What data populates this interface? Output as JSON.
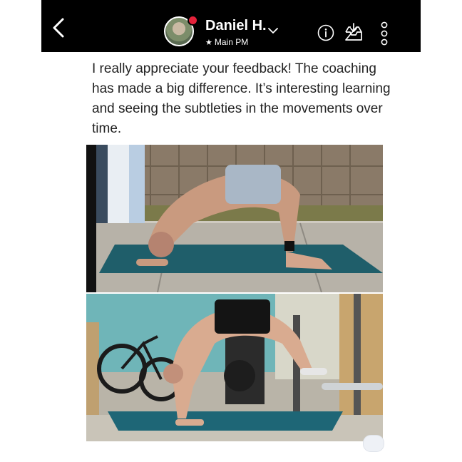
{
  "header": {
    "contact_name": "Daniel H.",
    "contact_subtitle": "Main PM",
    "subtitle_icon": "star-icon",
    "presence_color": "#e4223a",
    "icons": [
      "back-arrow-icon",
      "chevron-down-icon",
      "info-icon",
      "inbox-download-icon",
      "more-vertical-icon"
    ]
  },
  "message": {
    "text": "I really appreciate your feedback! The coaching has made a big difference. It’s interesting learning and seeing the subtleties in the movements over time."
  },
  "attachments": [
    "photo",
    "photo"
  ],
  "colors": {
    "header_bg": "#000000",
    "background": "#ffffff",
    "text": "#222222"
  }
}
